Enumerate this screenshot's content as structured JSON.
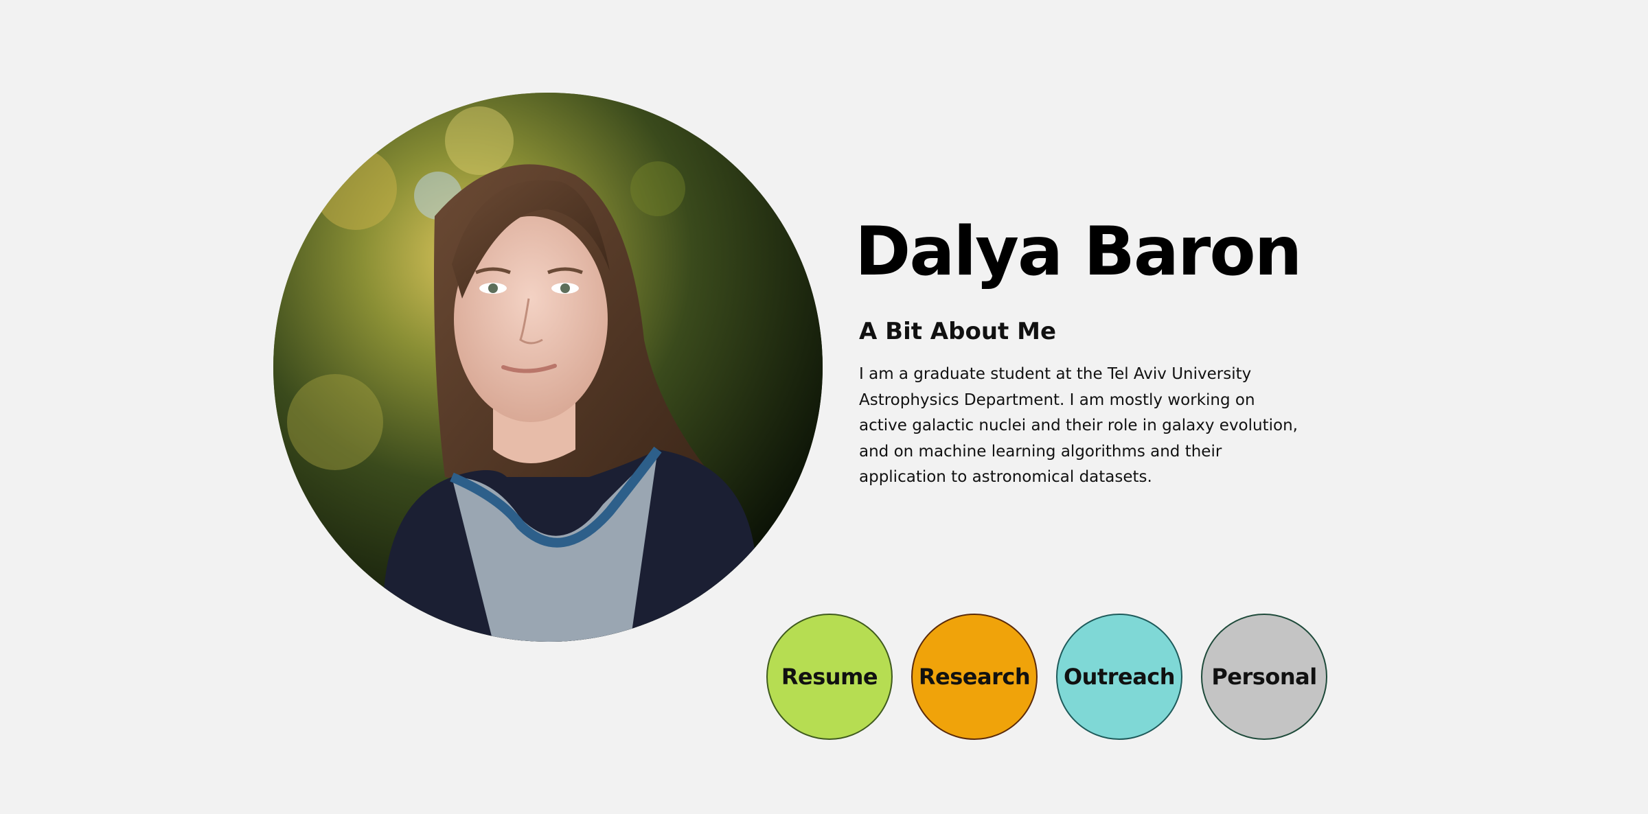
{
  "profile": {
    "name": "Dalya Baron",
    "photo_alt": "portrait-photo"
  },
  "about": {
    "heading": "A Bit About Me",
    "text": "I am a graduate student at the Tel Aviv University Astrophysics Department. I am mostly working on active galactic nuclei and their role in galaxy evolution, and on machine learning algorithms and their application to astronomical datasets."
  },
  "nav": [
    {
      "label": "Resume",
      "color": "#b6dd52",
      "border": "#3f5a1e"
    },
    {
      "label": "Research",
      "color": "#f0a30a",
      "border": "#5a2a0a"
    },
    {
      "label": "Outreach",
      "color": "#7fd8d6",
      "border": "#1e5a5a"
    },
    {
      "label": "Personal",
      "color": "#c4c4c4",
      "border": "#1e4a3a"
    }
  ],
  "colors": {
    "background": "#f2f2f2",
    "text": "#111111"
  }
}
